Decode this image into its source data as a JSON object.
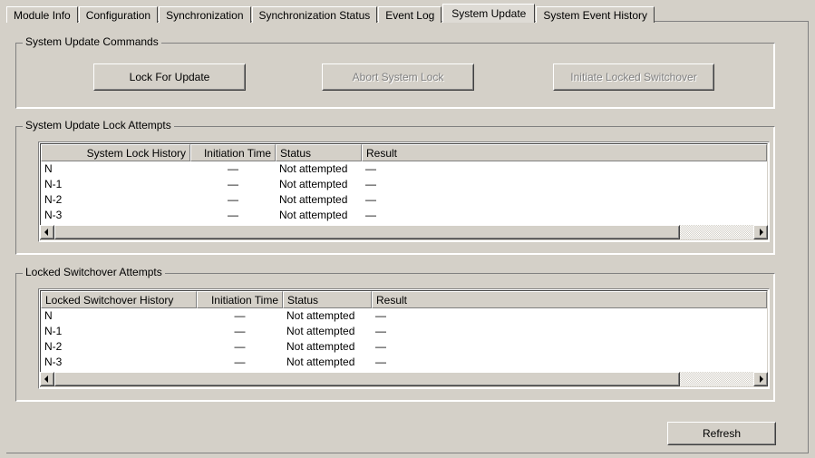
{
  "tabs": [
    {
      "label": "Module Info",
      "active": false
    },
    {
      "label": "Configuration",
      "active": false
    },
    {
      "label": "Synchronization",
      "active": false
    },
    {
      "label": "Synchronization Status",
      "active": false
    },
    {
      "label": "Event Log",
      "active": false
    },
    {
      "label": "System Update",
      "active": true
    },
    {
      "label": "System Event History",
      "active": false
    }
  ],
  "commands_group": {
    "title": "System Update Commands",
    "buttons": [
      {
        "label": "Lock For Update",
        "enabled": true
      },
      {
        "label": "Abort System Lock",
        "enabled": false
      },
      {
        "label": "Initiate Locked Switchover",
        "enabled": false
      }
    ]
  },
  "lock_attempts_group": {
    "title": "System Update Lock Attempts",
    "columns": [
      "System Lock History",
      "Initiation Time",
      "Status",
      "Result"
    ],
    "rows": [
      {
        "history": "N",
        "initiation_time": "—",
        "status": "Not attempted",
        "result": "—"
      },
      {
        "history": "N-1",
        "initiation_time": "—",
        "status": "Not attempted",
        "result": "—"
      },
      {
        "history": "N-2",
        "initiation_time": "—",
        "status": "Not attempted",
        "result": "—"
      },
      {
        "history": "N-3",
        "initiation_time": "—",
        "status": "Not attempted",
        "result": "—"
      }
    ],
    "scrollbar": {
      "left_arrow_icon": "triangle-left-icon",
      "right_arrow_icon": "triangle-right-icon"
    }
  },
  "switchover_attempts_group": {
    "title": "Locked Switchover Attempts",
    "columns": [
      "Locked Switchover History",
      "Initiation Time",
      "Status",
      "Result"
    ],
    "rows": [
      {
        "history": "N",
        "initiation_time": "—",
        "status": "Not attempted",
        "result": "—"
      },
      {
        "history": "N-1",
        "initiation_time": "—",
        "status": "Not attempted",
        "result": "—"
      },
      {
        "history": "N-2",
        "initiation_time": "—",
        "status": "Not attempted",
        "result": "—"
      },
      {
        "history": "N-3",
        "initiation_time": "—",
        "status": "Not attempted",
        "result": "—"
      }
    ],
    "scrollbar": {
      "left_arrow_icon": "triangle-left-icon",
      "right_arrow_icon": "triangle-right-icon"
    }
  },
  "footer": {
    "refresh_label": "Refresh"
  },
  "colors": {
    "window_background": "#d4d0c8",
    "list_background": "#ffffff",
    "text": "#000000",
    "disabled_text": "#808080",
    "border_dark": "#404040",
    "border_shadow": "#808080",
    "border_light": "#ffffff"
  }
}
